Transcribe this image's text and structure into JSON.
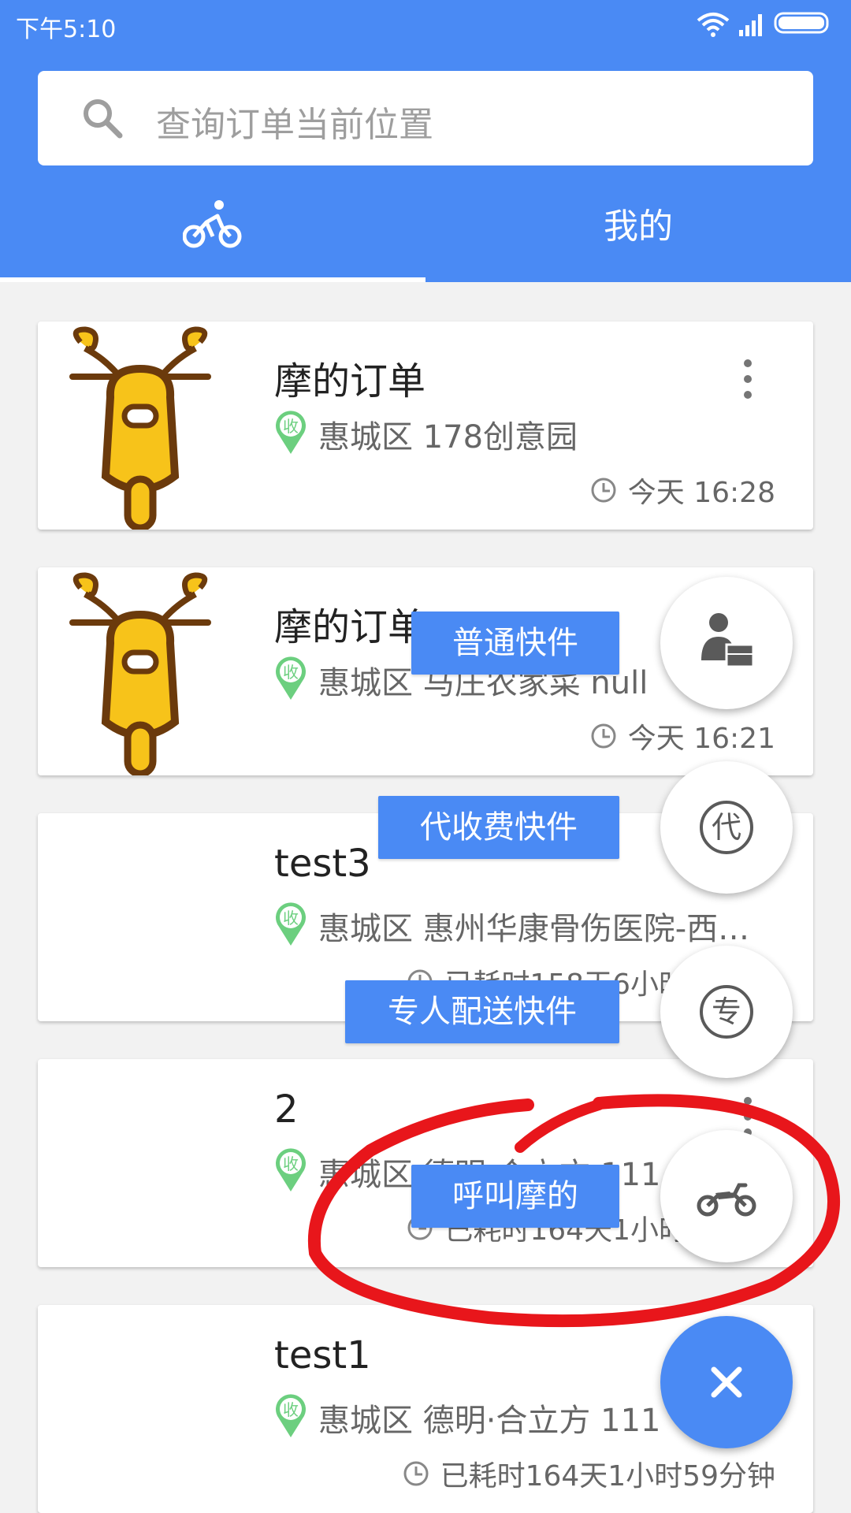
{
  "status_bar": {
    "time": "下午5:10"
  },
  "search": {
    "placeholder": "查询订单当前位置"
  },
  "tabs": [
    {
      "icon": "bicycle-icon",
      "selected": true
    },
    {
      "label": "我的",
      "selected": false
    }
  ],
  "orders": [
    {
      "title": "摩的订单",
      "badge": "收",
      "address": "惠城区 178创意园",
      "time": "今天 16:28",
      "thumb": "scooter-icon"
    },
    {
      "title": "摩的订单",
      "badge": "收",
      "address": "惠城区 马庄农家菜 null",
      "time": "今天 16:21",
      "thumb": "scooter-icon"
    },
    {
      "title": "test3",
      "badge": "收",
      "address": "惠城区 惠州华康骨伤医院-西…",
      "time": "已耗时158天6小时"
    },
    {
      "title": "2",
      "badge": "收",
      "address": "惠城区 德明·合立方 111",
      "time": "已耗时164天1小时"
    },
    {
      "title": "test1",
      "badge": "收",
      "address": "惠城区 德明·合立方 111",
      "time": "已耗时164天1小时59分钟"
    }
  ],
  "fab_menu": [
    {
      "label": "普通快件",
      "icon": "courier-package-icon"
    },
    {
      "label": "代收费快件",
      "icon": "collect-fee-icon",
      "glyph": "代"
    },
    {
      "label": "专人配送快件",
      "icon": "dedicated-delivery-icon",
      "glyph": "专"
    },
    {
      "label": "呼叫摩的",
      "icon": "motorcycle-icon"
    }
  ],
  "fab_main": {
    "icon": "close-icon"
  },
  "colors": {
    "primary": "#4a8af4",
    "badge_green": "#6ccf7f",
    "annotation_red": "#e8161b",
    "scooter_yellow": "#f7c31a",
    "scooter_brown": "#6b3a0c"
  }
}
